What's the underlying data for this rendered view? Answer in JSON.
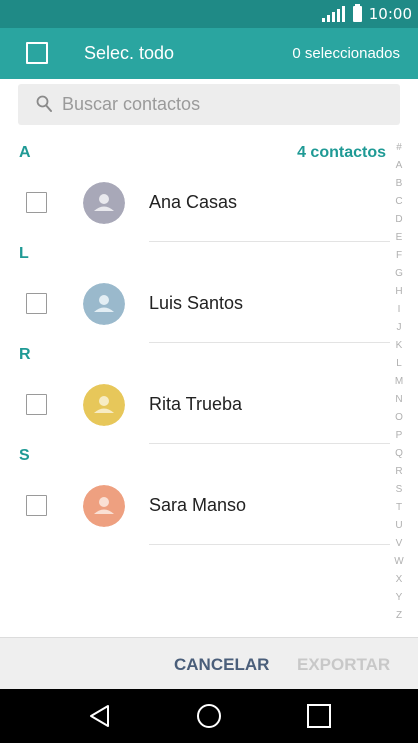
{
  "status_bar": {
    "time": "10:00",
    "signal_icon": "signal-icon",
    "battery_icon": "battery-icon"
  },
  "header": {
    "select_all_label": "Selec. todo",
    "selected_count": "0 seleccionados"
  },
  "search": {
    "placeholder": "Buscar contactos",
    "value": ""
  },
  "contacts_count": "4 contactos",
  "sections": [
    {
      "letter": "A",
      "contacts": [
        {
          "name": "Ana Casas",
          "avatar_color": "#a8a8b8"
        }
      ]
    },
    {
      "letter": "L",
      "contacts": [
        {
          "name": "Luis Santos",
          "avatar_color": "#9ab9cc"
        }
      ]
    },
    {
      "letter": "R",
      "contacts": [
        {
          "name": "Rita Trueba",
          "avatar_color": "#e7c75a"
        }
      ]
    },
    {
      "letter": "S",
      "contacts": [
        {
          "name": "Sara Manso",
          "avatar_color": "#eea080"
        }
      ]
    }
  ],
  "index_letters": [
    "#",
    "A",
    "B",
    "C",
    "D",
    "E",
    "F",
    "G",
    "H",
    "I",
    "J",
    "K",
    "L",
    "M",
    "N",
    "O",
    "P",
    "Q",
    "R",
    "S",
    "T",
    "U",
    "V",
    "W",
    "X",
    "Y",
    "Z"
  ],
  "actions": {
    "cancel_label": "CANCELAR",
    "export_label": "EXPORTAR"
  },
  "colors": {
    "status_bar": "#1f8a86",
    "app_bar": "#2aa5a0",
    "accent_text": "#1f9a95",
    "cancel_text": "#4a5e7a",
    "export_disabled_text": "#c8c8c8"
  }
}
